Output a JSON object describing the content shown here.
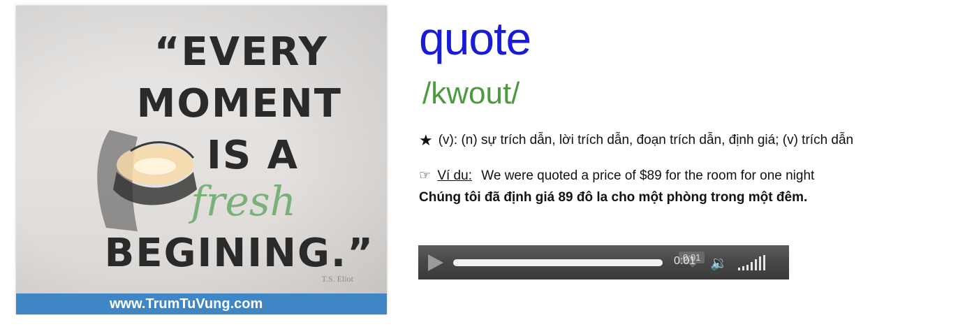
{
  "image_card": {
    "quote_lines": [
      "“EVERY",
      "MOMENT",
      "IS A",
      "fresh",
      "BEGINING.”"
    ],
    "author": "T.S. Eliot",
    "banner": "www.TrumTuVung.com"
  },
  "entry": {
    "word": "quote",
    "phonetic": "/kwout/",
    "definition": "(v): (n) sự trích dẫn, lời trích dẫn, đoạn trích dẫn, định giá; (v) trích dẫn",
    "example_label": "Ví du:",
    "example_text": "We were quoted a price of $89 for the room for one night",
    "translation": "Chúng tôi đã định giá 89 đô la cho một phòng trong một đêm."
  },
  "player": {
    "tooltip_time": "0:01",
    "current_time": "0:01",
    "progress_fraction": 1.0,
    "volume_level": 1.0
  },
  "icons": {
    "definition": "star-icon",
    "example": "pointing-hand-icon",
    "play": "play-icon",
    "volume": "speaker-icon"
  }
}
